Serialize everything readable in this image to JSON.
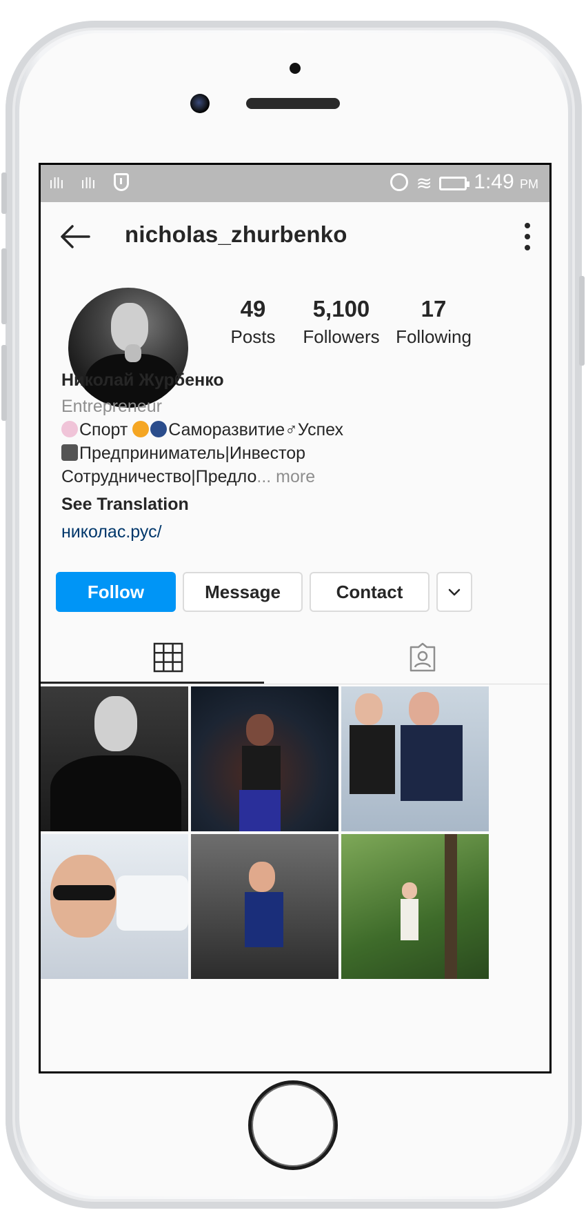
{
  "status_bar": {
    "signal_1": "ıllı",
    "signal_2": "ıllı",
    "time": "1:49",
    "meridiem": "PM"
  },
  "header": {
    "username": "nicholas_zhurbenko",
    "back_icon": "arrow-left-icon",
    "menu_icon": "vertical-dots-icon"
  },
  "profile": {
    "stats": [
      {
        "value": "49",
        "label": "Posts"
      },
      {
        "value": "5,100",
        "label": "Followers"
      },
      {
        "value": "17",
        "label": "Following"
      }
    ],
    "name": "Николай Журбенко",
    "category": "Entrepreneur",
    "bio_line_1_a": "Спорт",
    "bio_line_1_b": "Саморазвитие",
    "bio_line_1_c": "♂Успех",
    "bio_line_2": "Предприниматель|Инвестор",
    "bio_line_3": "Сотрудничество|Предло",
    "ellipsis": "...",
    "more": " more",
    "see_translation": "See Translation",
    "link": "николас.рус/"
  },
  "actions": {
    "follow": "Follow",
    "message": "Message",
    "contact": "Contact"
  },
  "tabs": [
    {
      "name": "grid-icon",
      "active": true
    },
    {
      "name": "tagged-icon",
      "active": false
    }
  ],
  "colors": {
    "accent": "#0095f6",
    "link": "#00376b",
    "status_bar": "#b9b9b9"
  }
}
